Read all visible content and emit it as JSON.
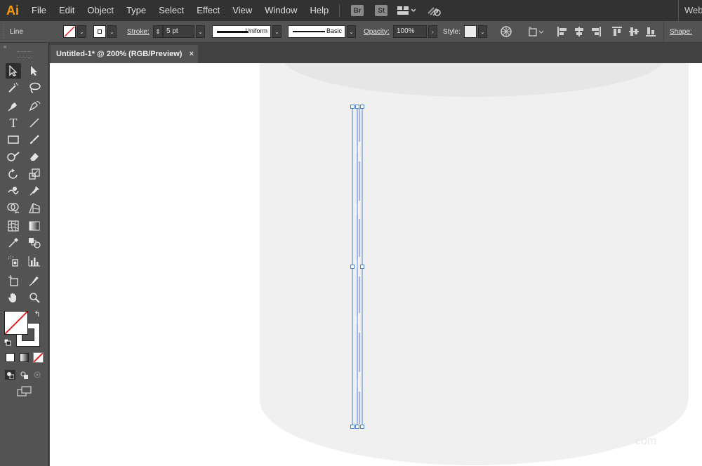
{
  "app": {
    "logo": "Ai",
    "workspace": "Web",
    "accent": "#ff9a00"
  },
  "menu": {
    "items": [
      "File",
      "Edit",
      "Object",
      "Type",
      "Select",
      "Effect",
      "View",
      "Window",
      "Help"
    ],
    "bridge": "Br",
    "stock": "St"
  },
  "control_bar": {
    "selection_type": "Line",
    "stroke_label": "Stroke:",
    "stroke_weight": "5 pt",
    "profile": "Uniform",
    "brush": "Basic",
    "opacity_label": "Opacity:",
    "opacity_value": "100%",
    "style_label": "Style:",
    "shape_label": "Shape:"
  },
  "panel": {
    "collapse": "«"
  },
  "document": {
    "tab_title": "Untitled-1* @ 200% (RGB/Preview)",
    "close": "×"
  },
  "canvas": {
    "artwork_fill": "#f0f0f0",
    "artwork_top": "#e6e6e6",
    "selection_color": "#4a7fd6"
  },
  "watermark": "com",
  "icons": {
    "fill_swatch": "none-fill-icon",
    "stroke_swatch": "stroke-swatch-icon"
  }
}
